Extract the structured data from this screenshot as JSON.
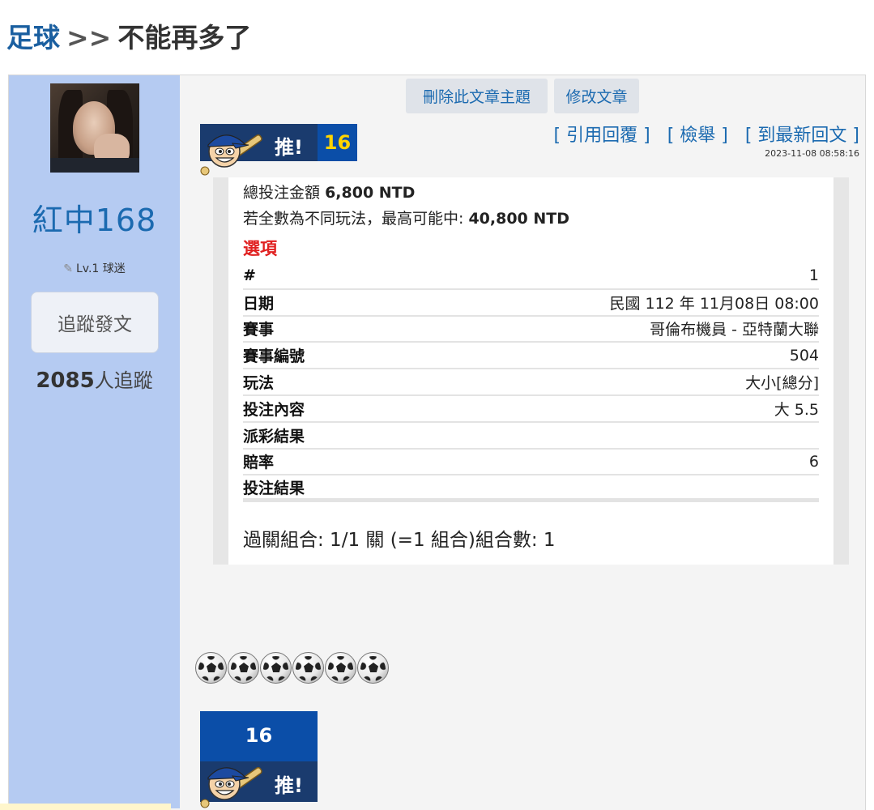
{
  "breadcrumb": {
    "category": "足球",
    "separator": ">>",
    "title": "不能再多了"
  },
  "user": {
    "name": "紅中168",
    "level": "Lv.1 球迷",
    "follow_label": "追蹤發文",
    "followers_count": "2085",
    "followers_suffix": "人追蹤"
  },
  "actions": {
    "delete_topic": "刪除此文章主題",
    "edit_post": "修改文章"
  },
  "push": {
    "label": "推!",
    "count": "16"
  },
  "post_links": {
    "quote_reply": "[ 引用回覆 ]",
    "report": "[ 檢舉 ]",
    "latest_reply": "[ 到最新回文 ]"
  },
  "post_time": "2023-11-08 08:58:16",
  "bet": {
    "total_label": "總投注金額",
    "total_value": "6,800 NTD",
    "max_label": "若全數為不同玩法，最高可能中:",
    "max_value": "40,800 NTD",
    "options_title": "選項",
    "rows": [
      {
        "key": "#",
        "value": "1"
      },
      {
        "key": "日期",
        "value": "民國 112 年 11月08日 08:00"
      },
      {
        "key": "賽事",
        "value": "哥倫布機員 - 亞特蘭大聯"
      },
      {
        "key": "賽事編號",
        "value": "504"
      },
      {
        "key": "玩法",
        "value": "大小[總分]"
      },
      {
        "key": "投注內容",
        "value": "大 5.5"
      },
      {
        "key": "派彩結果",
        "value": ""
      },
      {
        "key": "賠率",
        "value": "6"
      },
      {
        "key": "投注結果",
        "value": ""
      }
    ],
    "combo": "過關組合: 1/1 關 (=1 組合)組合數: 1"
  },
  "emoji_count": 6,
  "colors": {
    "sidebar": "#b5cbf2",
    "link": "#1b6ab0",
    "accent_red": "#e02020",
    "push_bar": "#1a3b6e",
    "push_count_bg": "#0b4ea8",
    "push_count_text": "#ffd400"
  }
}
